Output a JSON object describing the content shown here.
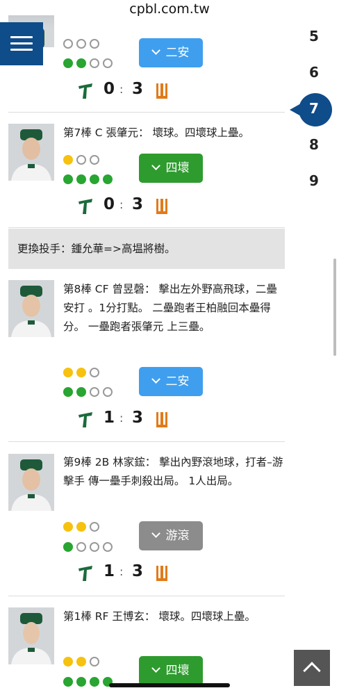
{
  "browser": {
    "url": "cpbl.com.tw"
  },
  "innings": [
    "5",
    "6",
    "7",
    "8",
    "9"
  ],
  "active_inning": "7",
  "plays": [
    {
      "description": "",
      "balls": [
        0,
        0,
        0
      ],
      "strikes": [
        0,
        0,
        0
      ],
      "outs": [
        1,
        1,
        0,
        0
      ],
      "result": "二安",
      "result_color": "#3f9fee",
      "score_home": "0",
      "score_away": "3"
    },
    {
      "description": "第7棒 C 張肇元： 壞球。四壞球上壘。",
      "balls": [
        1,
        0,
        0
      ],
      "outs": [
        1,
        1,
        1,
        1
      ],
      "result": "四壞",
      "result_color": "#2e9b2e",
      "score_home": "0",
      "score_away": "3"
    },
    {
      "description": "第8棒 CF 曾昱磬： 擊出左外野高飛球，二壘安打 。1分打點。 二壘跑者王柏融回本壘得分。 一壘跑者張肇元 上三壘。",
      "balls": [
        1,
        1,
        0
      ],
      "outs": [
        1,
        1,
        0,
        0
      ],
      "result": "二安",
      "result_color": "#3f9fee",
      "score_home": "1",
      "score_away": "3"
    },
    {
      "description": "第9棒 2B 林家鋐： 擊出內野滾地球，打者–游擊手 傳一壘手刺殺出局。 1人出局。",
      "balls": [
        1,
        1,
        0
      ],
      "outs": [
        1,
        0,
        0,
        0
      ],
      "result": "游滾",
      "result_color": "#8c8c8c",
      "score_home": "1",
      "score_away": "3"
    },
    {
      "description": "第1棒 RF 王博玄： 壞球。四壞球上壘。",
      "balls": [
        1,
        1,
        0
      ],
      "outs": [
        1,
        1,
        1,
        1
      ],
      "result": "四壞",
      "result_color": "#2e9b2e"
    }
  ],
  "substitution": "更換投手：鍾允華=>高塭將樹。",
  "colors": {
    "menu_blue": "#0f4c8a",
    "ball_yellow": "#f6c20f",
    "out_green": "#29a532",
    "team_green": "#1b6b3a",
    "team_orange": "#e07b1a"
  },
  "icons": {
    "menu": "hamburger-icon",
    "expand": "chevron-down-icon",
    "back_to_top": "chevron-up-icon"
  }
}
